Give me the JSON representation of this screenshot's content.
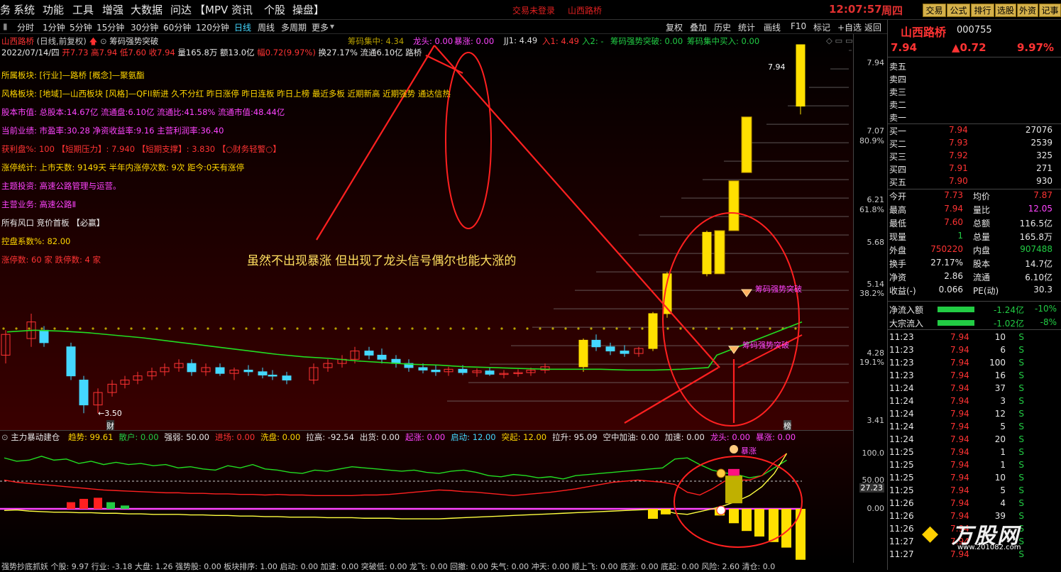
{
  "menu": {
    "items": [
      "务",
      "系统",
      "功能",
      "工具",
      "增强",
      "大数据",
      "问达",
      "【MPV 资讯",
      "个股",
      "操盘】"
    ],
    "status": [
      "交易未登录",
      "山西路桥"
    ],
    "clock": "12:07:57",
    "weekday": "周四",
    "buttons": [
      "交易",
      "公式",
      "排行",
      "选股",
      "外资",
      "记事"
    ]
  },
  "toolbar": {
    "periods": [
      "分时",
      "1分钟",
      "5分钟",
      "15分钟",
      "30分钟",
      "60分钟",
      "120分钟",
      "日线",
      "周线",
      "多周期",
      "更多"
    ],
    "actions": [
      "复权",
      "叠加",
      "历史",
      "统计",
      "画线",
      "F10",
      "标记",
      "+自选",
      "返回"
    ]
  },
  "chart": {
    "name": "山西路桥",
    "mode": "(日线,前复权)",
    "formula": "筹码强势突破",
    "indicators": [
      "筹码集中: 4.34",
      "龙头: 0.00",
      "暴涨: 0.00",
      "JJ1: 4.49",
      "入1: 4.49",
      "入2: -",
      "筹码强势突破: 0.00",
      "筹码集中买入: 0.00"
    ],
    "quote_prefix": "2022/07/14/四",
    "quote_open": "开7.73",
    "quote_high": "高7.94",
    "quote_low": "低7.60",
    "quote_close": "收7.94",
    "quote_vol": "量165.8万",
    "quote_amt": "额13.0亿",
    "quote_chg": "幅0.72(9.97%)",
    "quote_turn": "换27.17%",
    "quote_float": "流通6.10亿",
    "quote_tail": "路桥",
    "lines": [
      {
        "t": "所属板块:  [行业]—路桥 [概念]—聚氨酯",
        "c": "y"
      },
      {
        "t": "风格板块:  [地域]—山西板块 [风格]—QFII新进 久不分红 昨日涨停 昨日连板 昨日上榜 最近多板 近期新高 近期强势 通达信热",
        "c": "y"
      },
      {
        "t": "股本市值:    总股本:14.67亿 流通盘:6.10亿 流通比:41.58% 流通市值:48.44亿",
        "c": "m"
      },
      {
        "t": "当前业绩:    市盈率:30.28 净资收益率:9.16 主营利润率:36.40",
        "c": "m"
      },
      {
        "t": "获利盘%:          100     【短期压力】: 7.940    【短期支撑】:  3.830    【○财务轻警○】",
        "c": "r"
      },
      {
        "t": "涨停统计: 上市天数: 9149天 半年内涨停次数: 9次   距今:0天有涨停",
        "c": "y"
      },
      {
        "t": "主题投资:  高速公路管理与运营。",
        "c": "m"
      },
      {
        "t": "主营业务:  高速公路Ⅱ",
        "c": "m"
      },
      {
        "t": "所有风口 竞价首板 【必赢】",
        "c": "w"
      },
      {
        "t": "控盘系数%:  82.00",
        "c": "y"
      },
      {
        "t": "涨停数: 60 家      跌停数: 4 家",
        "c": "r"
      }
    ],
    "price_label": "7.94",
    "low_label": "←3.50",
    "cai": "财",
    "bang": "榜",
    "signal_label": "筹码强势突破",
    "annotation": "虽然不出现暴涨 但出现了龙头信号偶尔也能大涨的",
    "yticks": [
      "7.94",
      "7.07",
      "80.9%",
      "6.21",
      "61.8%",
      "5.68",
      "5.14",
      "38.2%",
      "4.28",
      "19.1%",
      "3.41"
    ]
  },
  "chart_data": {
    "type": "candlestick",
    "title": "山西路桥 (日线,前复权)",
    "candles": [
      [
        4.2,
        4.5,
        4.1,
        4.45
      ],
      [
        4.4,
        4.7,
        4.3,
        4.6
      ],
      [
        4.5,
        4.55,
        4.3,
        4.35
      ],
      [
        4.3,
        4.35,
        3.9,
        3.95
      ],
      [
        3.9,
        3.95,
        3.5,
        3.6
      ],
      [
        3.6,
        3.8,
        3.5,
        3.75
      ],
      [
        3.75,
        3.9,
        3.7,
        3.85
      ],
      [
        3.85,
        3.95,
        3.8,
        3.9
      ],
      [
        3.9,
        4.0,
        3.85,
        3.95
      ],
      [
        3.95,
        4.05,
        3.9,
        4.0
      ],
      [
        4.0,
        4.1,
        3.95,
        4.05
      ],
      [
        4.05,
        4.15,
        4.0,
        4.1
      ],
      [
        4.1,
        4.15,
        3.95,
        4.0
      ],
      [
        4.0,
        4.1,
        3.95,
        4.05
      ],
      [
        4.05,
        4.1,
        3.95,
        3.98
      ],
      [
        3.98,
        4.05,
        3.9,
        4.02
      ],
      [
        4.02,
        4.08,
        3.95,
        4.0
      ],
      [
        4.0,
        4.05,
        3.92,
        3.96
      ],
      [
        3.96,
        4.02,
        3.9,
        3.95
      ],
      [
        3.95,
        4.0,
        3.85,
        3.9
      ],
      [
        3.9,
        4.1,
        3.85,
        4.05
      ],
      [
        4.05,
        4.15,
        4.0,
        4.1
      ],
      [
        4.1,
        4.2,
        4.05,
        4.15
      ],
      [
        4.15,
        4.3,
        4.1,
        4.25
      ],
      [
        4.25,
        4.3,
        4.15,
        4.2
      ],
      [
        4.2,
        4.28,
        4.1,
        4.15
      ],
      [
        4.15,
        4.2,
        4.05,
        4.1
      ],
      [
        4.1,
        4.15,
        4.0,
        4.05
      ],
      [
        4.05,
        4.1,
        3.98,
        4.02
      ],
      [
        4.02,
        4.08,
        3.95,
        4.0
      ],
      [
        4.0,
        4.06,
        3.95,
        4.03
      ],
      [
        4.03,
        4.08,
        3.96,
        3.99
      ],
      [
        3.99,
        4.04,
        3.94,
        4.01
      ],
      [
        4.01,
        4.05,
        3.95,
        3.97
      ],
      [
        3.97,
        4.02,
        3.92,
        3.98
      ],
      [
        3.98,
        4.03,
        3.94,
        3.99
      ],
      [
        3.99,
        4.05,
        3.95,
        4.02
      ],
      [
        4.02,
        4.1,
        3.98,
        4.06
      ],
      [
        4.06,
        4.4,
        4.0,
        4.38
      ],
      [
        4.38,
        4.45,
        4.25,
        4.3
      ],
      [
        4.3,
        4.35,
        4.2,
        4.25
      ],
      [
        4.25,
        4.32,
        4.18,
        4.22
      ],
      [
        4.22,
        4.3,
        4.18,
        4.28
      ],
      [
        4.28,
        4.72,
        4.25,
        4.7
      ],
      [
        4.7,
        5.2,
        4.65,
        5.18
      ],
      [
        5.18,
        5.7,
        5.15,
        5.68
      ],
      [
        7.2,
        7.94,
        7.1,
        7.94
      ]
    ],
    "ylim": [
      3.4,
      8.0
    ]
  },
  "sub1": {
    "title": "主力暴动建仓",
    "vals": [
      [
        "趋势: 99.61",
        "y"
      ],
      [
        "散户: 0.00",
        "g"
      ],
      [
        "强弱: 50.00",
        "w"
      ],
      [
        "进场: 0.00",
        "r"
      ],
      [
        "洗盘: 0.00",
        "y"
      ],
      [
        "拉高: -92.54",
        "w"
      ],
      [
        "出货: 0.00",
        "w"
      ],
      [
        "起涨: 0.00",
        "m"
      ],
      [
        "启动: 12.00",
        "c"
      ],
      [
        "突起: 12.00",
        "y"
      ],
      [
        "拉升: 95.09",
        "w"
      ],
      [
        "空中加油: 0.00",
        "w"
      ],
      [
        "加速: 0.00",
        "w"
      ],
      [
        "龙头: 0.00",
        "m"
      ],
      [
        "暴涨: 0.00",
        "m"
      ]
    ],
    "yticks": [
      "100.0",
      "50.00",
      "27.23",
      "0.00"
    ],
    "baozhang": "暴涨"
  },
  "bottom": "强势抄底抓妖   个股: 9.97  行业: -3.18  大盘: 1.26  强势股: 0.00  板块排序: 1.00  启动: 0.00  加速: 0.00  突破低: 0.00  龙飞: 0.00  回撤: 0.00  失气: 0.00  冲天: 0.00  顺上飞: 0.00  底涨: 0.00  底起: 0.00  风险: 2.60  清仓: 0.0",
  "panel": {
    "name": "山西路桥",
    "code": "000755",
    "price": "7.94",
    "change": "▲0.72",
    "pct": "9.97%",
    "sells": [
      "卖五",
      "卖四",
      "卖三",
      "卖二",
      "卖一"
    ],
    "buys": [
      [
        "买一",
        "7.94",
        "27076"
      ],
      [
        "买二",
        "7.93",
        "2539"
      ],
      [
        "买三",
        "7.92",
        "325"
      ],
      [
        "买四",
        "7.91",
        "271"
      ],
      [
        "买五",
        "7.90",
        "930"
      ]
    ],
    "stats": [
      [
        "今开",
        "7.73",
        "r",
        "均价",
        "7.87",
        "r"
      ],
      [
        "最高",
        "7.94",
        "r",
        "量比",
        "12.05",
        "m"
      ],
      [
        "最低",
        "7.60",
        "r",
        "总额",
        "116.5亿",
        "w"
      ],
      [
        "现量",
        "1",
        "g",
        "总量",
        "165.8万",
        "w"
      ],
      [
        "外盘",
        "750220",
        "r",
        "内盘",
        "907488",
        "g"
      ],
      [
        "换手",
        "27.17%",
        "w",
        "股本",
        "14.7亿",
        "w"
      ],
      [
        "净资",
        "2.86",
        "w",
        "流通",
        "6.10亿",
        "w"
      ],
      [
        "收益(-)",
        "0.066",
        "w",
        "PE(动)",
        "30.3",
        "w"
      ]
    ],
    "flows": [
      [
        "净流入额",
        "-1.24亿",
        "-10%"
      ],
      [
        "大宗流入",
        "-1.02亿",
        "-8%"
      ]
    ],
    "ticks": [
      [
        "11:23",
        "7.94",
        "10",
        "S"
      ],
      [
        "11:23",
        "7.94",
        "6",
        "S"
      ],
      [
        "11:23",
        "7.94",
        "100",
        "S"
      ],
      [
        "11:23",
        "7.94",
        "16",
        "S"
      ],
      [
        "11:24",
        "7.94",
        "37",
        "S"
      ],
      [
        "11:24",
        "7.94",
        "3",
        "S"
      ],
      [
        "11:24",
        "7.94",
        "12",
        "S"
      ],
      [
        "11:24",
        "7.94",
        "5",
        "S"
      ],
      [
        "11:24",
        "7.94",
        "20",
        "S"
      ],
      [
        "11:25",
        "7.94",
        "1",
        "S"
      ],
      [
        "11:25",
        "7.94",
        "1",
        "S"
      ],
      [
        "11:25",
        "7.94",
        "10",
        "S"
      ],
      [
        "11:25",
        "7.94",
        "5",
        "S"
      ],
      [
        "11:26",
        "7.94",
        "4",
        "S"
      ],
      [
        "11:26",
        "7.94",
        "39",
        "S"
      ],
      [
        "11:26",
        "7.94",
        "",
        "S"
      ],
      [
        "11:27",
        "7.94",
        "",
        "S"
      ],
      [
        "11:27",
        "7.94",
        "",
        "S"
      ]
    ],
    "watermark": "万股网",
    "watermark_url": "www.201082.com"
  }
}
